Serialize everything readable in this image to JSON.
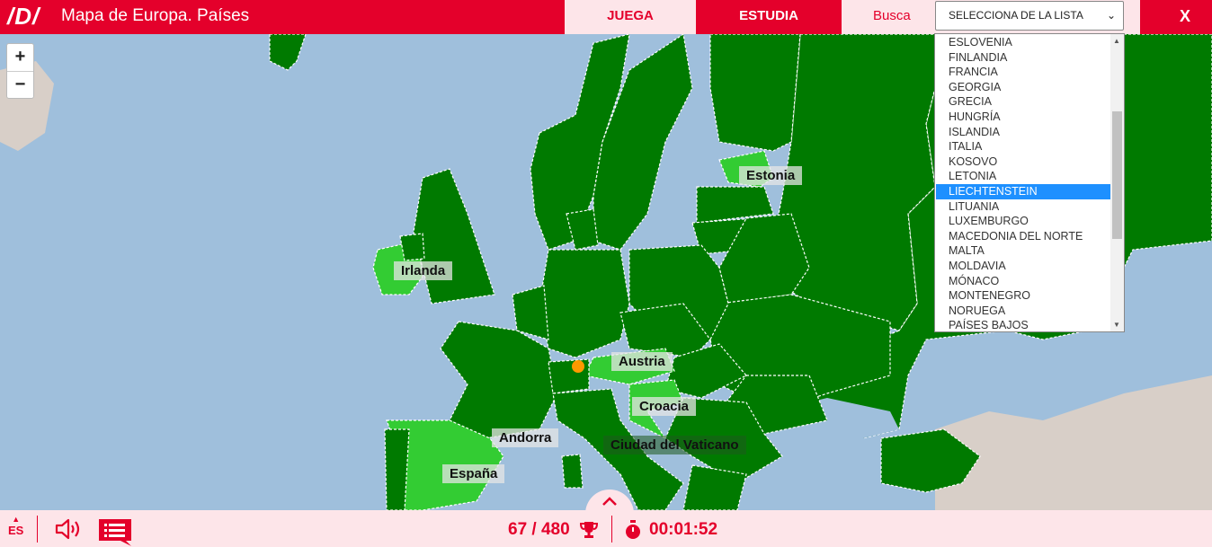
{
  "header": {
    "logo": "/D/",
    "title": "Mapa de Europa. Países",
    "tabs": {
      "play": "JUEGA",
      "study": "ESTUDIA",
      "search": "Busca"
    },
    "select_value": "SELECCIONA DE LA LISTA",
    "close": "X"
  },
  "zoom": {
    "in": "+",
    "out": "−"
  },
  "dropdown": {
    "items": [
      "ESLOVENIA",
      "FINLANDIA",
      "FRANCIA",
      "GEORGIA",
      "GRECIA",
      "HUNGRÍA",
      "ISLANDIA",
      "ITALIA",
      "KOSOVO",
      "LETONIA",
      "LIECHTENSTEIN",
      "LITUANIA",
      "LUXEMBURGO",
      "MACEDONIA DEL NORTE",
      "MALTA",
      "MOLDAVIA",
      "MÓNACO",
      "MONTENEGRO",
      "NORUEGA",
      "PAÍSES BAJOS"
    ],
    "selected": "LIECHTENSTEIN"
  },
  "map_labels": {
    "estonia": "Estonia",
    "irlanda": "Irlanda",
    "austria": "Austria",
    "croacia": "Croacia",
    "andorra": "Andorra",
    "vaticano": "Ciudad del Vaticano",
    "espana": "España"
  },
  "footer": {
    "lang": "ES",
    "score": "67 / 480",
    "time": "00:01:52"
  },
  "colors": {
    "brand": "#e4002b",
    "sea": "#9fbfdc",
    "country_dark": "#007a00",
    "country_found": "#33cc33",
    "land_gray": "#d8cfc8",
    "marker": "#ff9900"
  }
}
